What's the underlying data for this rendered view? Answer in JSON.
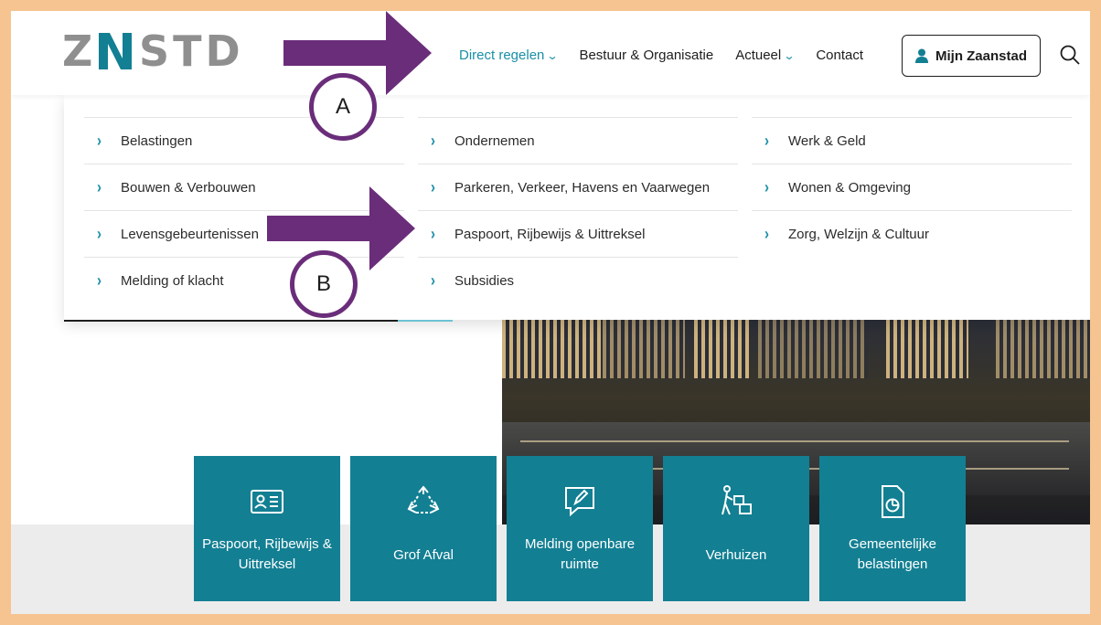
{
  "brand": {
    "logo_text": "ZNSTD"
  },
  "nav": {
    "items": [
      {
        "label": "Direct regelen",
        "has_dropdown": true,
        "active": true
      },
      {
        "label": "Bestuur & Organisatie",
        "has_dropdown": false
      },
      {
        "label": "Actueel",
        "has_dropdown": true
      },
      {
        "label": "Contact",
        "has_dropdown": false
      }
    ],
    "login_label": "Mijn Zaanstad",
    "search_icon": "search-icon"
  },
  "menu": {
    "columns": [
      [
        "Belastingen",
        "Bouwen & Verbouwen",
        "Levensgebeurtenissen",
        "Melding of klacht"
      ],
      [
        "Ondernemen",
        "Parkeren, Verkeer, Havens en Vaarwegen",
        "Paspoort, Rijbewijs & Uittreksel",
        "Subsidies"
      ],
      [
        "Werk & Geld",
        "Wonen & Omgeving",
        "Zorg, Welzijn & Cultuur"
      ]
    ]
  },
  "annotations": {
    "a": "A",
    "b": "B"
  },
  "tiles": [
    {
      "label": "Paspoort, Rijbewijs & Uittreksel",
      "icon": "id-card-icon"
    },
    {
      "label": "Grof Afval",
      "icon": "recycle-icon"
    },
    {
      "label": "Melding openbare ruimte",
      "icon": "speech-pencil-icon"
    },
    {
      "label": "Verhuizen",
      "icon": "moving-person-icon"
    },
    {
      "label": "Gemeentelijke belastingen",
      "icon": "tax-document-icon"
    }
  ],
  "colors": {
    "accent": "#1a8fa6",
    "tile": "#137f93",
    "annotation": "#6a2d7a",
    "frame": "#f6c490"
  }
}
